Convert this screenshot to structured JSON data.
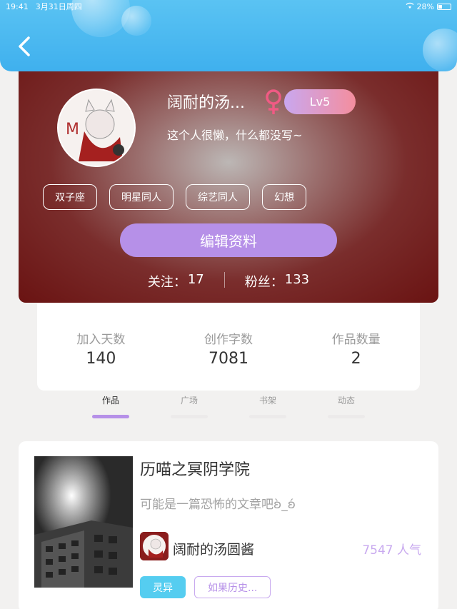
{
  "status_bar": {
    "time": "19:41",
    "date": "3月31日周四",
    "battery": "28%"
  },
  "header": {
    "back_icon": "chevron-left-icon"
  },
  "profile": {
    "nickname": "阔耐的汤...",
    "gender_icon": "female-icon",
    "level": "Lv5",
    "bio": "这个人很懒，什么都没写~",
    "tags": [
      "双子座",
      "明星同人",
      "综艺同人",
      "幻想"
    ],
    "edit_button": "编辑资料",
    "following_label": "关注：",
    "following_count": "17",
    "followers_label": "粉丝：",
    "followers_count": "133"
  },
  "stats": [
    {
      "label": "加入天数",
      "value": "140"
    },
    {
      "label": "创作字数",
      "value": "7081"
    },
    {
      "label": "作品数量",
      "value": "2"
    }
  ],
  "tabs": [
    "作品",
    "广场",
    "书架",
    "动态"
  ],
  "active_tab": "作品",
  "work": {
    "title": "历喵之冥阴学院",
    "description": "可能是一篇恐怖的文章吧ʚ̀_ʚ́",
    "author": "阔耐的汤圆酱",
    "popularity": "7547 人气",
    "tags": [
      "灵异",
      "如果历史..."
    ]
  },
  "colors": {
    "header": "#3fb0ee",
    "accent_purple": "#b690e8",
    "card_dark_red": "#6a1312",
    "tag_cyan": "#55cdf0"
  }
}
